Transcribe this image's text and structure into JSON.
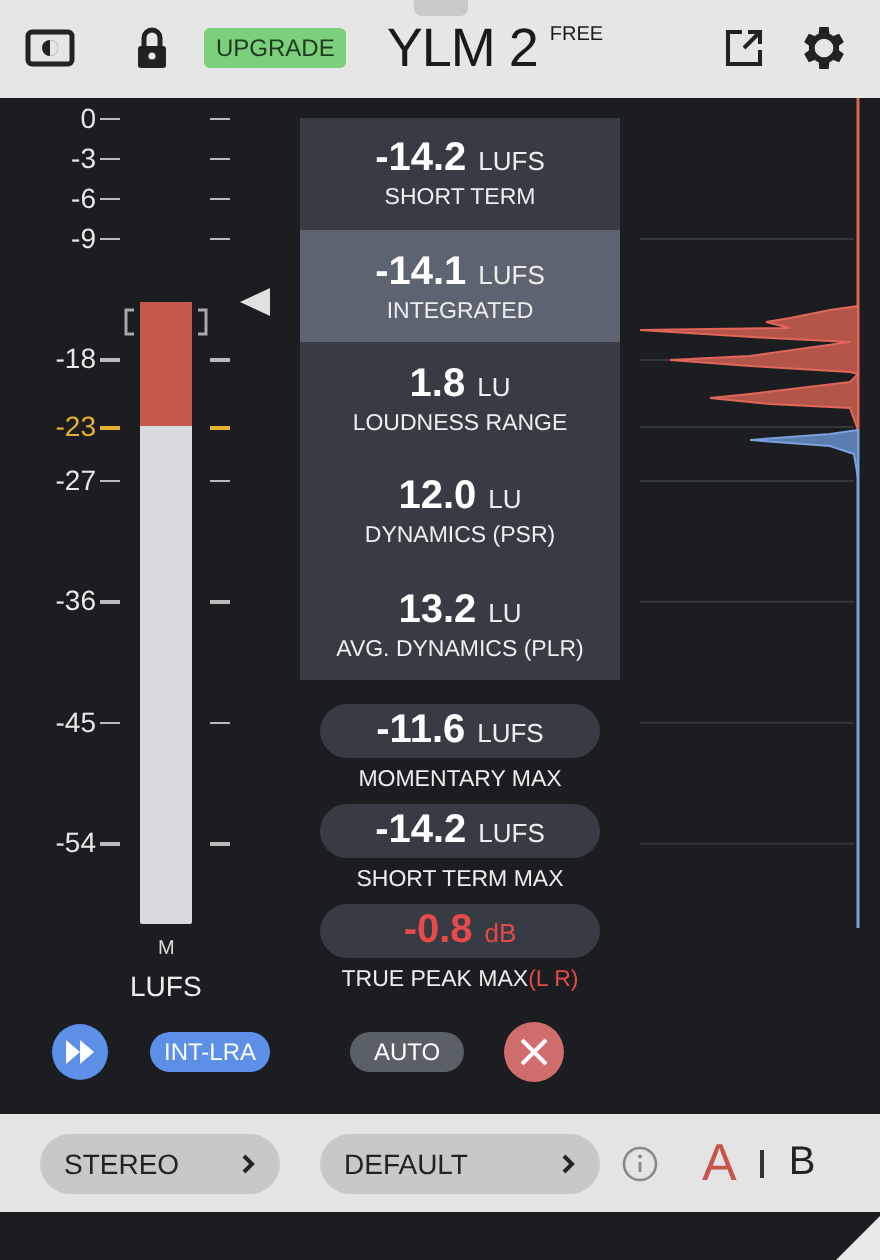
{
  "header": {
    "upgrade_badge": "UPGRADE",
    "title": "YLM 2",
    "edition": "FREE"
  },
  "meter": {
    "channel": "M",
    "unit": "LUFS",
    "scale": [
      {
        "label": "0",
        "target": false
      },
      {
        "label": "-3",
        "target": false
      },
      {
        "label": "-6",
        "target": false
      },
      {
        "label": "-9",
        "target": false
      },
      {
        "label": "-18",
        "target": false
      },
      {
        "label": "-23",
        "target": true
      },
      {
        "label": "-27",
        "target": false
      },
      {
        "label": "-36",
        "target": false
      },
      {
        "label": "-45",
        "target": false
      },
      {
        "label": "-54",
        "target": false
      }
    ]
  },
  "readings": [
    {
      "value": "-14.2",
      "unit": "LUFS",
      "label": "SHORT TERM",
      "selected": false
    },
    {
      "value": "-14.1",
      "unit": "LUFS",
      "label": "INTEGRATED",
      "selected": true
    },
    {
      "value": "1.8",
      "unit": "LU",
      "label": "LOUDNESS RANGE",
      "selected": false
    },
    {
      "value": "12.0",
      "unit": "LU",
      "label": "DYNAMICS (PSR)",
      "selected": false
    },
    {
      "value": "13.2",
      "unit": "LU",
      "label": "AVG. DYNAMICS (PLR)",
      "selected": false
    }
  ],
  "max_readings": [
    {
      "value": "-11.6",
      "unit": "LUFS",
      "label": "MOMENTARY MAX",
      "alert": false
    },
    {
      "value": "-14.2",
      "unit": "LUFS",
      "label": "SHORT TERM MAX",
      "alert": false
    },
    {
      "value": "-0.8",
      "unit": "dB",
      "label": "TRUE PEAK MAX",
      "channels": "(L R)",
      "alert": true
    }
  ],
  "controls": {
    "mode_badge": "INT-LRA",
    "auto_button": "AUTO"
  },
  "footer": {
    "channel_select": "STEREO",
    "preset_select": "DEFAULT",
    "ab": [
      {
        "label": "A",
        "selected": true
      },
      {
        "label": "B",
        "selected": false
      }
    ]
  }
}
